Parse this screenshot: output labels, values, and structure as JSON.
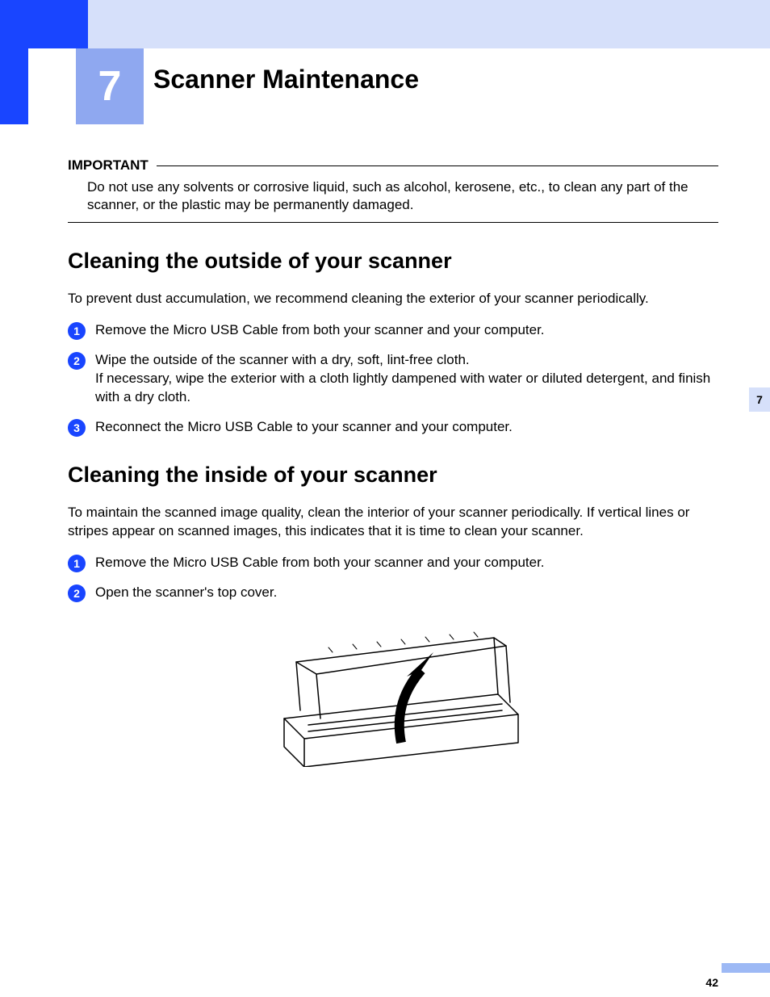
{
  "chapter": {
    "number": "7",
    "title": "Scanner Maintenance"
  },
  "important": {
    "label": "IMPORTANT",
    "text": "Do not use any solvents or corrosive liquid, such as alcohol, kerosene, etc., to clean any part of the scanner, or the plastic may be permanently damaged."
  },
  "section1": {
    "heading": "Cleaning the outside of your scanner",
    "intro": "To prevent dust accumulation, we recommend cleaning the exterior of your scanner periodically.",
    "steps": {
      "s1": "Remove the Micro USB Cable from both your scanner and your computer.",
      "s2": "Wipe the outside of the scanner with a dry, soft, lint-free cloth.\nIf necessary, wipe the exterior with a cloth lightly dampened with water or diluted detergent, and finish with a dry cloth.",
      "s3": "Reconnect the Micro USB Cable to your scanner and your computer."
    }
  },
  "section2": {
    "heading": "Cleaning the inside of your scanner",
    "intro": "To maintain the scanned image quality, clean the interior of your scanner periodically. If vertical lines or stripes appear on scanned images, this indicates that it is time to clean your scanner.",
    "steps": {
      "s1": "Remove the Micro USB Cable from both your scanner and your computer.",
      "s2": "Open the scanner's top cover."
    }
  },
  "sideTab": "7",
  "pageNumber": "42"
}
